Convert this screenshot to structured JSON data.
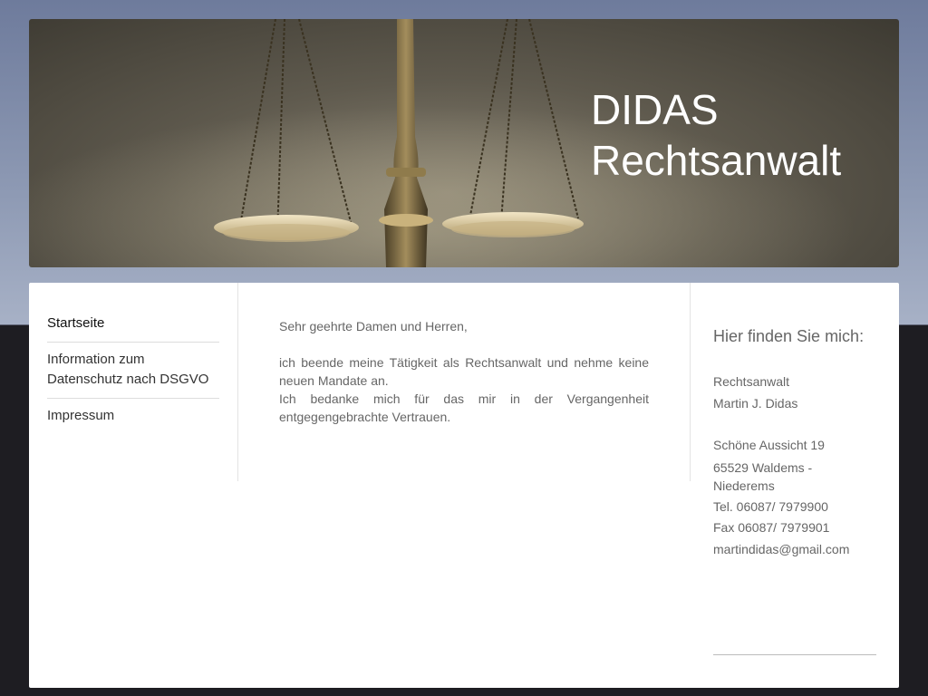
{
  "header": {
    "title_line1": "DIDAS",
    "title_line2": "Rechtsanwalt"
  },
  "nav": {
    "items": [
      {
        "label": "Startseite"
      },
      {
        "label": "Information zum Datenschutz nach DSGVO"
      },
      {
        "label": "Impressum"
      }
    ]
  },
  "main": {
    "greeting": "Sehr geehrte Damen und Herren,",
    "paragraph1": "ich beende meine Tätigkeit als Rechtsanwalt und nehme  keine neuen Mandate an.",
    "paragraph2": "Ich bedanke mich für das mir in der Vergangenheit entgegengebrachte Vertrauen."
  },
  "sidebar": {
    "heading": "Hier finden Sie mich:",
    "profession": "Rechtsanwalt",
    "name": "Martin J. Didas",
    "street": "Schöne Aussicht 19",
    "town": "65529 Waldems - Niederems",
    "phone": "Tel. 06087/ 7979900",
    "fax": "Fax 06087/ 7979901",
    "email": "martindidas@gmail.com"
  },
  "colors": {
    "background_top": "#8e9ab4",
    "background_bottom": "#1e1d22",
    "text": "#666666",
    "header_text": "#ffffff"
  }
}
